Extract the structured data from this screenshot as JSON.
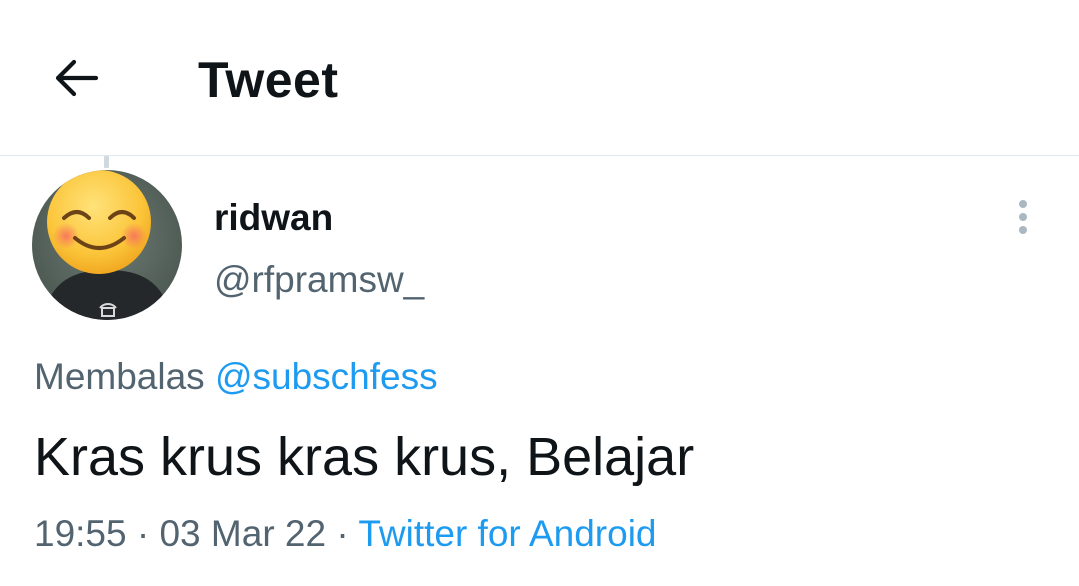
{
  "header": {
    "title": "Tweet",
    "back_icon": "arrow-left-icon"
  },
  "tweet": {
    "author": {
      "display_name": "ridwan",
      "handle": "@rfpramsw_",
      "avatar_icon": "smiling-face-avatar"
    },
    "reply_prefix": "Membalas",
    "reply_to": "@subschfess",
    "text": "Kras krus kras krus, Belajar",
    "time": "19:55",
    "date": "03 Mar 22",
    "separator": "·",
    "source": "Twitter for Android",
    "more_icon": "more-vertical-icon"
  },
  "colors": {
    "accent": "#1d9bf0",
    "secondary_text": "#536471",
    "primary_text": "#0f1419",
    "divider": "#e1e8ed"
  }
}
